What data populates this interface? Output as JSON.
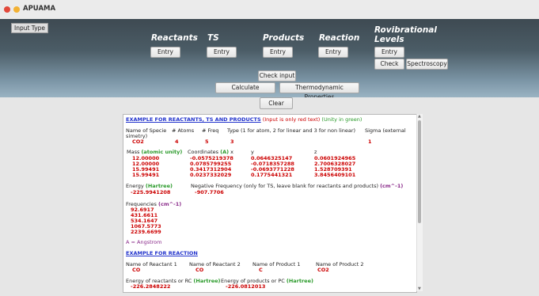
{
  "window": {
    "title": "APUAMA"
  },
  "header": {
    "input_type": "Input Type",
    "labels": {
      "reactants": "Reactants",
      "ts": "TS",
      "products": "Products",
      "reaction": "Reaction",
      "rovib_1": "Rovibrational",
      "rovib_2": "Levels"
    },
    "entry": "Entry",
    "check": "Check",
    "spectroscopy": "Spectroscopy",
    "check_input": "Check input",
    "calculate": "Calculate",
    "thermo": "Thermodynamic Properties"
  },
  "clear": "Clear",
  "example": {
    "title": "EXAMPLE FOR REACTANTS, TS AND PRODUCTS",
    "note_red": "(Input is only red text)",
    "note_green": "(Unity in green)",
    "h_name": "Name of Specie",
    "h_name2": "simetry)",
    "h_atoms": "# Atoms",
    "h_freq": "# Freq",
    "h_type": "Type (1 for atom, 2 for linear and 3 for non linear)",
    "h_sigma": "Sigma (external",
    "v_name": "CO2",
    "v_atoms": "4",
    "v_freq": "5",
    "v_type": "3",
    "v_sigma": "1",
    "mass_label": "Mass",
    "mass_unit": "(atomic unity)",
    "masses": [
      "12.00000",
      "12.00000",
      "15.99491",
      "15.99491"
    ],
    "coord_label": "Coordinates",
    "coord_unit": "(A)",
    "coord_x": "x",
    "coord_y": "y",
    "coord_z": "z",
    "xs": [
      "-0.0575219378",
      "0.0785799255",
      "0.3417312904",
      "0.0237332029"
    ],
    "ys": [
      "0.0646325147",
      "-0.0718357288",
      "-0.0693771228",
      "0.1775441321"
    ],
    "zs": [
      "0.0601924965",
      "2.7006328027",
      "1.528709391",
      "3.8456409101"
    ],
    "energy_label": "Energy",
    "energy_unit": "(Hartree)",
    "energy_value": "-225.9941208",
    "negfreq_label": "Negative Frequency (only for TS, leave blank for reactants and products)",
    "negfreq_unit": "(cm^-1)",
    "negfreq_value": "-907.7706",
    "freq_label": "Frequencies",
    "freq_unit": "(cm^-1)",
    "freqs": [
      "92.6917",
      "431.6611",
      "534.1647",
      "1067.5773",
      "2239.6699"
    ],
    "angstrom_note": "A = Angstrom"
  },
  "reaction_example": {
    "title": "EXAMPLE FOR REACTION",
    "h_r1": "Name of Reactant 1",
    "h_r2": "Name of Reactant 2",
    "h_p1": "Name of Product 1",
    "h_p2": "Name of Product 2",
    "v_r1": "CO",
    "v_r2": "CO",
    "v_p1": "C",
    "v_p2": "CO2",
    "e_react": "Energy of reactants or RC",
    "e_prod": "Energy of products or PC",
    "e_unit": "(Hartree)",
    "e_react_value": "-226.2848222",
    "e_prod_value": "-226.0812013"
  },
  "colors": {
    "header_top": "#3e4a52",
    "header_bottom": "#9ab3c2",
    "input_red": "#cc0000",
    "unit_green": "#2a9a2a",
    "link_blue": "#2233cc"
  }
}
